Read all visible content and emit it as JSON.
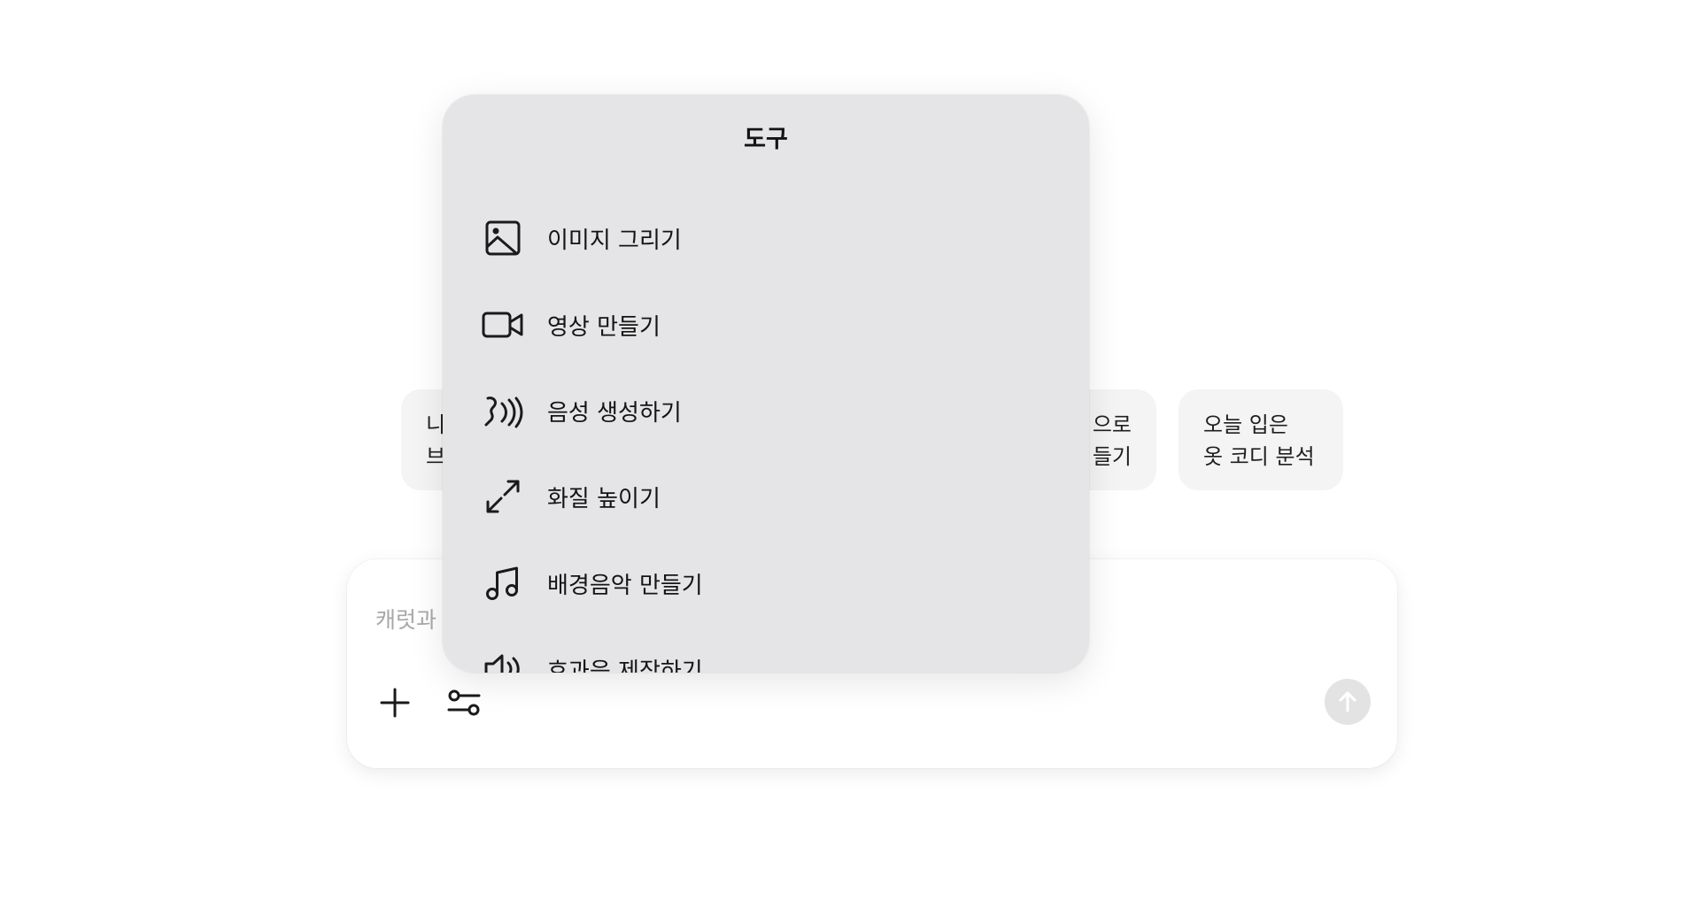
{
  "suggestions": [
    {
      "line1": "니",
      "line2": "브"
    },
    {
      "line1": "으로",
      "line2": "들기"
    },
    {
      "line1": "오늘 입은",
      "line2": "옷 코디 분석"
    }
  ],
  "composer": {
    "placeholder": "캐럿과"
  },
  "tools_menu": {
    "title": "도구",
    "items": [
      {
        "label": "이미지 그리기",
        "icon": "image-icon"
      },
      {
        "label": "영상 만들기",
        "icon": "video-camera-icon"
      },
      {
        "label": "음성 생성하기",
        "icon": "voice-wave-icon"
      },
      {
        "label": "화질 높이기",
        "icon": "expand-arrows-icon"
      },
      {
        "label": "배경음악 만들기",
        "icon": "music-note-icon"
      },
      {
        "label": "효과음 제작하기",
        "icon": "speaker-icon"
      }
    ]
  }
}
